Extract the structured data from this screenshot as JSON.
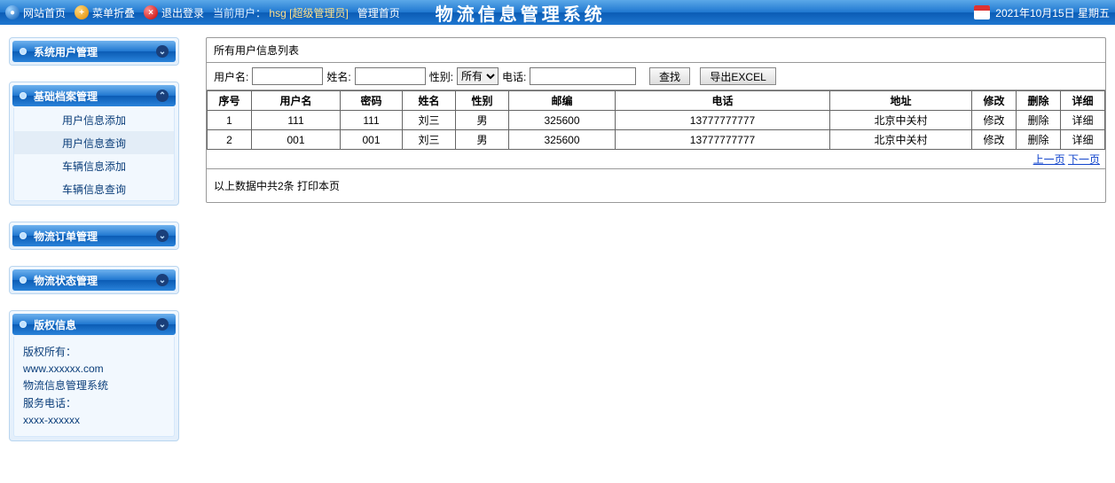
{
  "topbar": {
    "home": "网站首页",
    "collapse": "菜单折叠",
    "logout": "退出登录",
    "current_user_label": "当前用户：",
    "current_user": "hsg",
    "role": "[超级管理员]",
    "admin_home": "管理首页",
    "title": "物流信息管理系统",
    "date": "2021年10月15日 星期五"
  },
  "sidebar": {
    "panels": [
      {
        "title": "系统用户管理",
        "chev": "v"
      },
      {
        "title": "基础档案管理",
        "chev": "^",
        "items": [
          {
            "label": "用户信息添加"
          },
          {
            "label": "用户信息查询",
            "active": true
          },
          {
            "label": "车辆信息添加"
          },
          {
            "label": "车辆信息查询"
          }
        ]
      },
      {
        "title": "物流订单管理",
        "chev": "v"
      },
      {
        "title": "物流状态管理",
        "chev": "v"
      },
      {
        "title": "版权信息",
        "chev": "v",
        "copyright": {
          "l1": "版权所有：",
          "l2": "www.xxxxxx.com",
          "l3": "物流信息管理系统",
          "l4": "服务电话：",
          "l5": "xxxx-xxxxxx"
        }
      }
    ]
  },
  "content": {
    "card_title": "所有用户信息列表",
    "filter": {
      "user_label": "用户名:",
      "user_value": "",
      "name_label": "姓名:",
      "name_value": "",
      "sex_label": "性别:",
      "sex_value": "所有",
      "phone_label": "电话:",
      "phone_value": "",
      "search_btn": "查找",
      "export_btn": "导出EXCEL"
    },
    "columns": [
      "序号",
      "用户名",
      "密码",
      "姓名",
      "性别",
      "邮编",
      "电话",
      "地址",
      "修改",
      "删除",
      "详细"
    ],
    "rows": [
      {
        "idx": "1",
        "user": "111",
        "pwd": "111",
        "name": "刘三",
        "sex": "男",
        "zip": "325600",
        "phone": "13777777777",
        "addr": "北京中关村",
        "edit": "修改",
        "del": "删除",
        "detail": "详细"
      },
      {
        "idx": "2",
        "user": "001",
        "pwd": "001",
        "name": "刘三",
        "sex": "男",
        "zip": "325600",
        "phone": "13777777777",
        "addr": "北京中关村",
        "edit": "修改",
        "del": "删除",
        "detail": "详细"
      }
    ],
    "pager_prev": "上一页",
    "pager_next": "下一页",
    "summary_prefix": "以上数据中共2条 ",
    "print": "打印本页"
  }
}
